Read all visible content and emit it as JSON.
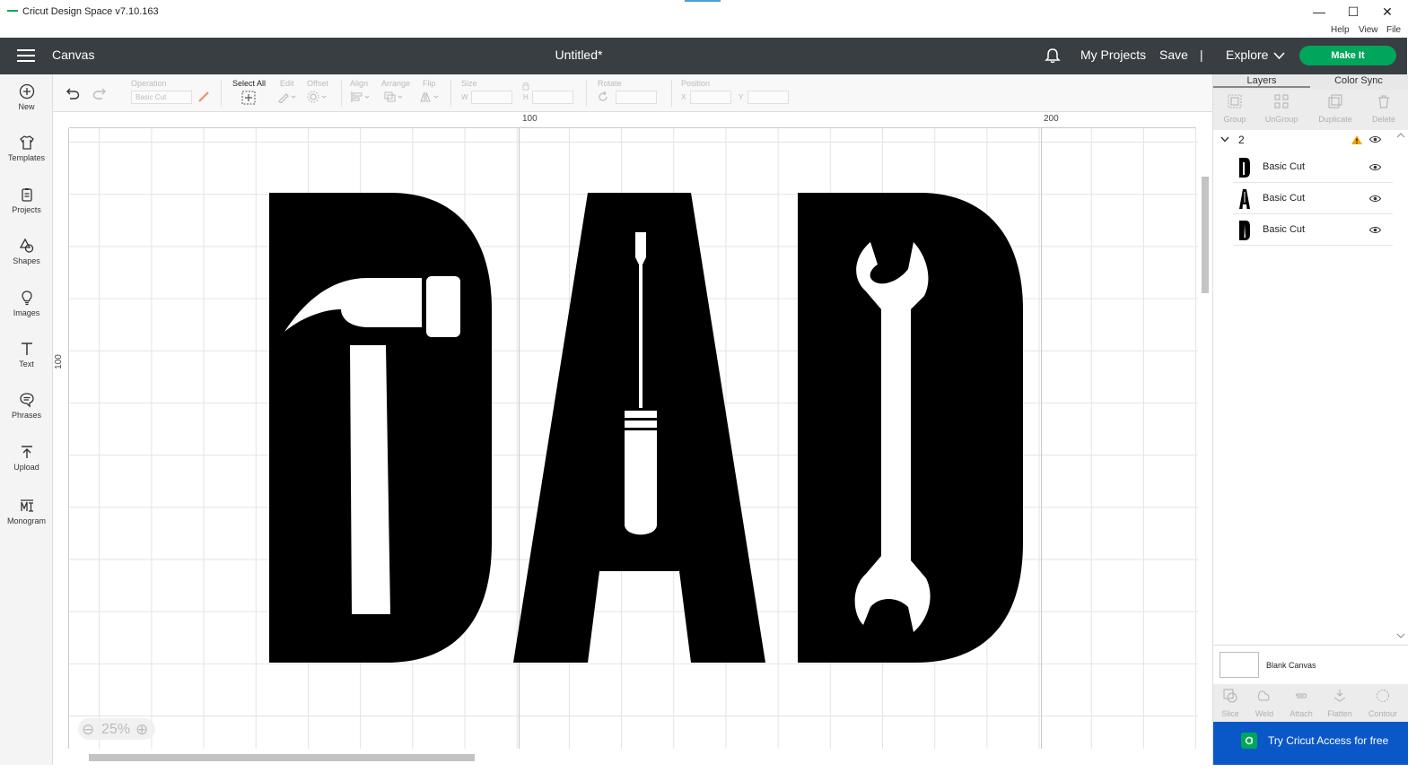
{
  "window": {
    "app_title": "Cricut Design Space  v7.10.163",
    "controls": [
      "—",
      "☐",
      "✕"
    ],
    "menu": [
      "Help",
      "View",
      "File"
    ]
  },
  "header": {
    "canvas_label": "Canvas",
    "document_title": "Untitled*",
    "my_projects": "My Projects",
    "save": "Save",
    "separator": "|",
    "explore": "Explore",
    "make_it": "Make It"
  },
  "sidebar": {
    "items": [
      {
        "label": "New",
        "icon": "plus-circle-icon"
      },
      {
        "label": "Templates",
        "icon": "shirt-icon"
      },
      {
        "label": "Projects",
        "icon": "projects-icon"
      },
      {
        "label": "Shapes",
        "icon": "shapes-icon"
      },
      {
        "label": "Images",
        "icon": "lightbulb-icon"
      },
      {
        "label": "Text",
        "icon": "text-icon"
      },
      {
        "label": "Phrases",
        "icon": "speech-bubble-icon"
      },
      {
        "label": "Upload",
        "icon": "upload-icon"
      },
      {
        "label": "Monogram",
        "icon": "monogram-icon"
      }
    ]
  },
  "toolbar": {
    "operation_label": "Operation",
    "operation_value": "Basic Cut",
    "select_all": "Select All",
    "edit": "Edit",
    "offset": "Offset",
    "align": "Align",
    "arrange": "Arrange",
    "flip": "Flip",
    "size": "Size",
    "w": "W",
    "h": "H",
    "rotate": "Rotate",
    "position": "Position",
    "x": "X",
    "y": "Y"
  },
  "canvas": {
    "ruler_top": [
      "100",
      "200"
    ],
    "ruler_left": [
      "100"
    ],
    "zoom": "25%",
    "zoom_minus": "−",
    "zoom_plus": "+",
    "design_text": "DAD"
  },
  "right_panel": {
    "tabs": [
      "Layers",
      "Color Sync"
    ],
    "actions_top": [
      "Group",
      "UnGroup",
      "Duplicate",
      "Delete"
    ],
    "group_name": "2",
    "layers": [
      {
        "name": "Basic Cut",
        "letter": "D"
      },
      {
        "name": "Basic Cut",
        "letter": "A"
      },
      {
        "name": "Basic Cut",
        "letter": "D"
      }
    ],
    "blank_canvas": "Blank Canvas",
    "actions_bottom": [
      "Slice",
      "Weld",
      "Attach",
      "Flatten",
      "Contour"
    ],
    "access_cta": "Try Cricut Access for free"
  },
  "colors": {
    "header_bg": "#393e43",
    "make_it": "#00a65b",
    "access_bg": "#0a58c7",
    "warning": "#f0a500"
  }
}
